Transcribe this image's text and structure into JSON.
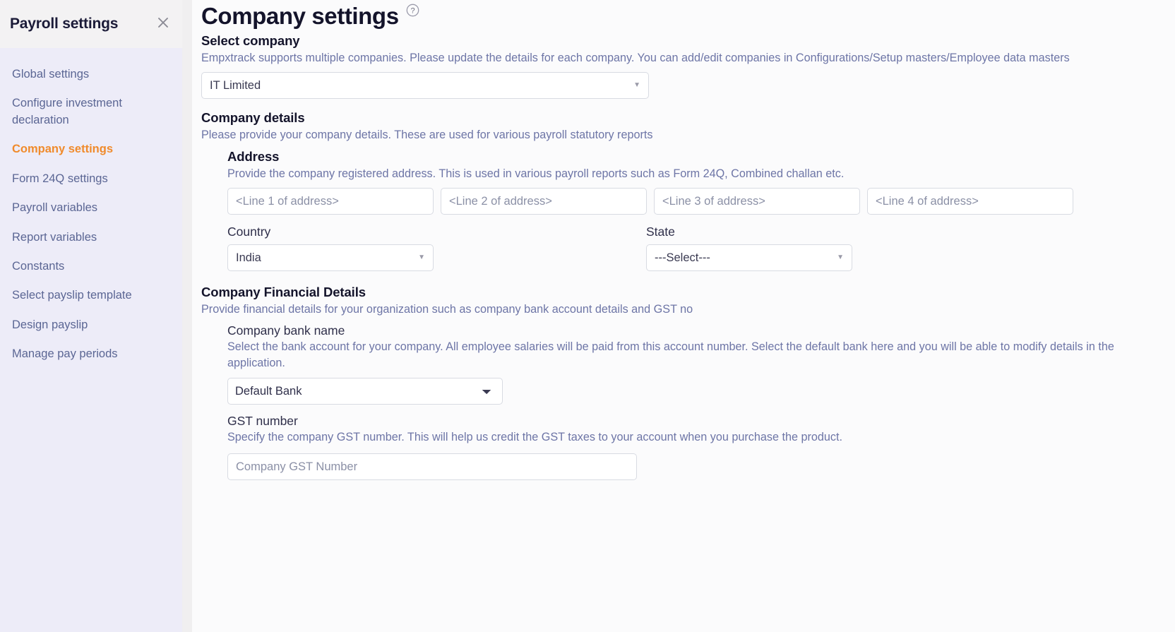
{
  "sidebar": {
    "title": "Payroll settings",
    "close_icon": "close-icon",
    "items": [
      {
        "label": "Global settings",
        "active": false
      },
      {
        "label": "Configure investment declaration",
        "active": false
      },
      {
        "label": "Company settings",
        "active": true
      },
      {
        "label": "Form 24Q settings",
        "active": false
      },
      {
        "label": "Payroll variables",
        "active": false
      },
      {
        "label": "Report variables",
        "active": false
      },
      {
        "label": "Constants",
        "active": false
      },
      {
        "label": "Select payslip template",
        "active": false
      },
      {
        "label": "Design payslip",
        "active": false
      },
      {
        "label": "Manage pay periods",
        "active": false
      }
    ]
  },
  "page": {
    "title": "Company settings",
    "help_icon": "help-circle-icon"
  },
  "select_company": {
    "heading": "Select company",
    "description": "Empxtrack supports multiple companies. Please update the details for each company. You can add/edit companies in Configurations/Setup masters/Employee data masters",
    "value": "IT Limited",
    "caret": "▼"
  },
  "company_details": {
    "heading": "Company details",
    "description": "Please provide your company details. These are used for various payroll statutory reports",
    "address": {
      "heading": "Address",
      "description": "Provide the company registered address. This is used in various payroll reports such as Form 24Q, Combined challan etc.",
      "lines": [
        {
          "placeholder": "<Line 1 of address>",
          "value": ""
        },
        {
          "placeholder": "<Line 2 of address>",
          "value": ""
        },
        {
          "placeholder": "<Line 3 of address>",
          "value": ""
        },
        {
          "placeholder": "<Line 4 of address>",
          "value": ""
        }
      ]
    },
    "country": {
      "label": "Country",
      "value": "India",
      "caret": "▼"
    },
    "state": {
      "label": "State",
      "value": "---Select---",
      "caret": "▼"
    }
  },
  "financial_details": {
    "heading": "Company Financial Details",
    "description": "Provide financial details for your organization such as company bank account details and GST no",
    "bank": {
      "label": "Company bank name",
      "description": "Select the bank account for your company. All employee salaries will be paid from this account number. Select the default bank here and you will be able to modify details in the application.",
      "value": "Default Bank",
      "options": [
        "Default Bank"
      ]
    },
    "gst": {
      "label": "GST number",
      "description": "Specify the company GST number. This will help us credit the GST taxes to your account when you purchase the product.",
      "placeholder": "Company GST Number",
      "value": ""
    }
  }
}
